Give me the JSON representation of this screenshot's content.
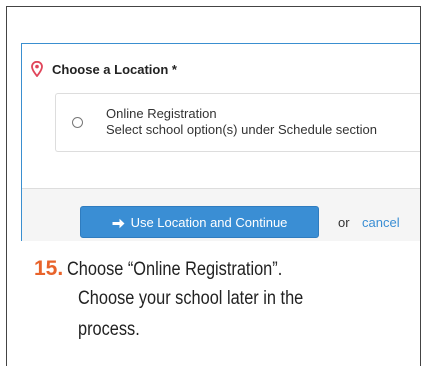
{
  "panel": {
    "title": "Choose a Location *",
    "accent_color": "#3a8fd0",
    "pin_color": "#e0455a",
    "pin_icon": "map-pin-icon"
  },
  "option": {
    "title": "Online Registration",
    "description": "Select school option(s) under Schedule section",
    "selected": false
  },
  "footer": {
    "continue_label": "Use Location and Continue",
    "continue_icon": "arrow-right-icon",
    "or_text": "or",
    "cancel_label": "cancel",
    "button_color": "#3a8ed4"
  },
  "instruction": {
    "step_number": "15.",
    "line1": "Choose “Online Registration”.",
    "line2": "Choose your school later in the",
    "line3": "process.",
    "step_color": "#e8632b"
  }
}
